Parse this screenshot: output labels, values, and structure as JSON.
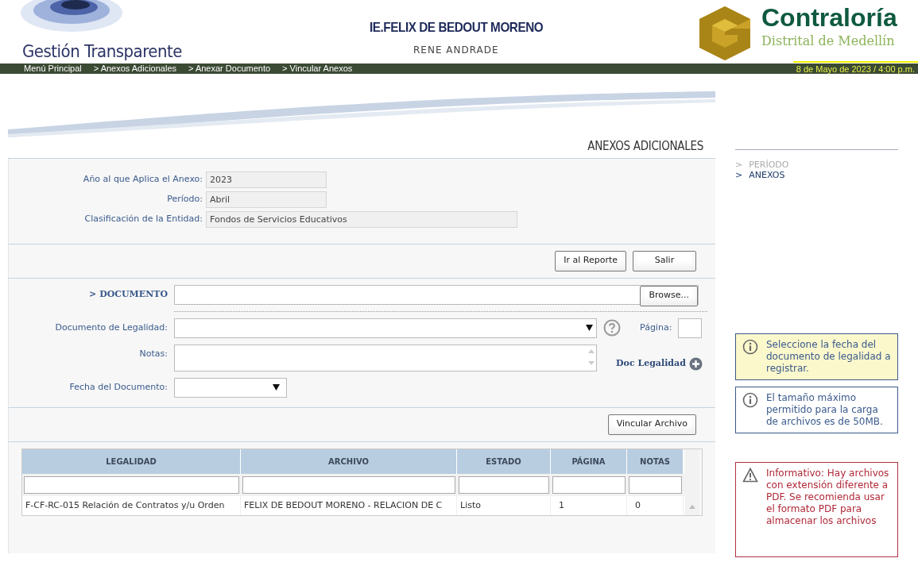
{
  "header": {
    "logo_text": "Gestión Transparente",
    "institution": "IE.FELIX DE BEDOUT MORENO",
    "user": "RENE ANDRADE",
    "brand_name": "Contraloría",
    "brand_subtitle": "Distrital de Medellín"
  },
  "breadcrumb": [
    "Menú Principal",
    "> Anexos Adicionales",
    "> Anexar Documento",
    "> Vincular Anexos"
  ],
  "date": "8 de Mayo de 2023 / 4:00 p.m.",
  "page_title": "ANEXOS ADICIONALES",
  "info_fields": [
    {
      "label": "Año al que Aplica el Anexo:",
      "value": "2023",
      "kind": "short"
    },
    {
      "label": "Período:",
      "value": "Abril",
      "kind": "short"
    },
    {
      "label": "Clasificación de la Entidad:",
      "value": "Fondos de Servicios Educativos",
      "kind": "long"
    }
  ],
  "actions": [
    "Ir al Reporte",
    "Salir"
  ],
  "document": {
    "label": "> DOCUMENTO",
    "button": "Browse..."
  },
  "legalidad": {
    "label": "Documento de Legalidad:",
    "page_label": "Página:"
  },
  "notas": {
    "label": "Notas:",
    "link": "Doc Legalidad"
  },
  "fecha": {
    "label": "Fecha del Documento:"
  },
  "link_button": "Vincular Archivo",
  "table": {
    "columns": [
      "LEGALIDAD",
      "ARCHIVO",
      "ESTADO",
      "PÁGINA",
      "NOTAS"
    ],
    "rows": [
      [
        "F-CF-RC-015 Relación de Contratos y/u Orden",
        "FELIX DE BEDOUT MORENO - RELACION DE C",
        "Listo",
        "1",
        "0"
      ]
    ]
  },
  "steps": [
    {
      "marker": ">",
      "label": "PERÍODO",
      "selected": false
    },
    {
      "marker": ">",
      "label": "ANEXOS",
      "selected": true
    }
  ],
  "notices": [
    {
      "kind": "info",
      "highlighted": true,
      "text": "Seleccione la fecha del documento de legalidad a registrar."
    },
    {
      "kind": "info",
      "highlighted": false,
      "text": "El tamaño máximo permitido para la carga de archivos es de 50MB."
    },
    {
      "kind": "warning",
      "highlighted": false,
      "text": "Informativo: Hay archivos con extensión diferente a PDF. Se recomienda usar el formato PDF para almacenar los archivos"
    }
  ]
}
